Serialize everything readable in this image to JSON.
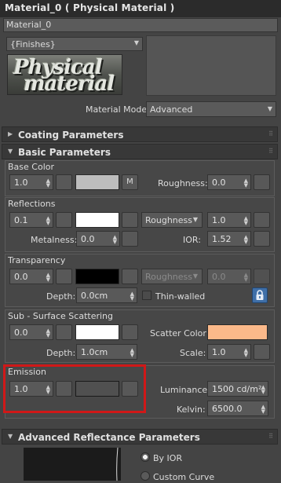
{
  "title": "Material_0  ( Physical Material )",
  "material_name": "Material_0",
  "preset_dropdown": "{Finishes}",
  "logo_text": [
    "Physical",
    "material"
  ],
  "material_mode": {
    "label": "Material Mode:",
    "value": "Advanced"
  },
  "rollouts": {
    "coating": "Coating Parameters",
    "basic": "Basic Parameters",
    "advanced": "Advanced Reflectance Parameters"
  },
  "base_color": {
    "title": "Base Color",
    "weight": "1.0",
    "color": "#bdbdbd",
    "map_button": "M",
    "roughness_label": "Roughness:",
    "roughness": "0.0"
  },
  "reflections": {
    "title": "Reflections",
    "weight": "0.1",
    "color": "#ffffff",
    "mode": "Roughness",
    "roughness": "1.0",
    "metalness_label": "Metalness:",
    "metalness": "0.0",
    "ior_label": "IOR:",
    "ior": "1.52"
  },
  "transparency": {
    "title": "Transparency",
    "weight": "0.0",
    "color": "#000000",
    "mode": "Roughness",
    "roughness": "0.0",
    "depth_label": "Depth:",
    "depth": "0.0cm",
    "thin_walled_label": "Thin-walled"
  },
  "sss": {
    "title": "Sub - Surface Scattering",
    "weight": "0.0",
    "color": "#ffffff",
    "scatter_label": "Scatter Color:",
    "scatter_color": "#fbb98a",
    "depth_label": "Depth:",
    "depth": "1.0cm",
    "scale_label": "Scale:",
    "scale": "1.0"
  },
  "emission": {
    "title": "Emission",
    "weight": "1.0",
    "color": "#505050",
    "luminance_label": "Luminance:",
    "luminance": "1500 cd/m²",
    "kelvin_label": "Kelvin:",
    "kelvin": "6500.0"
  },
  "advanced_options": {
    "by_ior": "By IOR",
    "custom_curve": "Custom Curve"
  }
}
